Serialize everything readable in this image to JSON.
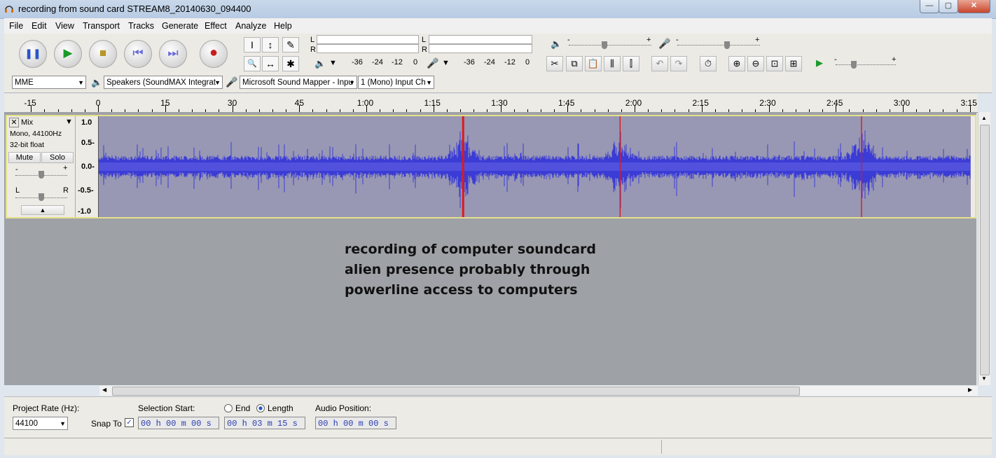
{
  "window": {
    "title": "recording from sound card STREAM8_20140630_094400",
    "minimize": "—",
    "maximize": "▢",
    "close": "✕"
  },
  "menu": [
    "File",
    "Edit",
    "View",
    "Transport",
    "Tracks",
    "Generate",
    "Effect",
    "Analyze",
    "Help"
  ],
  "transport": {
    "pause": "❚❚",
    "play": "▶",
    "stop": "■",
    "skip_start": "⏮",
    "skip_end": "⏭",
    "record": "●"
  },
  "tools": {
    "select": "I",
    "envelope": "↕",
    "draw": "✎",
    "zoom": "🔍",
    "timeshift": "↔",
    "multi": "✱"
  },
  "meters": {
    "play_L": "L",
    "play_R": "R",
    "rec_L": "L",
    "rec_R": "R",
    "scale": [
      "-36",
      "-24",
      "-12",
      "0"
    ]
  },
  "mixer": {
    "out_minus": "-",
    "out_plus": "+",
    "in_minus": "-",
    "in_plus": "+",
    "speed_minus": "-",
    "speed_plus": "+"
  },
  "devices": {
    "host": "MME",
    "output": "Speakers (SoundMAX Integrat",
    "input": "Microsoft Sound Mapper - Inpu",
    "channels": "1 (Mono) Input Ch"
  },
  "ruler": {
    "labels": [
      {
        "t": "-15",
        "s": -15
      },
      {
        "t": "0",
        "s": 0
      },
      {
        "t": "15",
        "s": 15
      },
      {
        "t": "30",
        "s": 30
      },
      {
        "t": "45",
        "s": 45
      },
      {
        "t": "1:00",
        "s": 60
      },
      {
        "t": "1:15",
        "s": 75
      },
      {
        "t": "1:30",
        "s": 90
      },
      {
        "t": "1:45",
        "s": 105
      },
      {
        "t": "2:00",
        "s": 120
      },
      {
        "t": "2:15",
        "s": 135
      },
      {
        "t": "2:30",
        "s": 150
      },
      {
        "t": "2:45",
        "s": 165
      },
      {
        "t": "3:00",
        "s": 180
      },
      {
        "t": "3:15",
        "s": 195
      }
    ]
  },
  "track": {
    "name": "Mix",
    "info_rate": "Mono, 44100Hz",
    "info_format": "32-bit float",
    "mute": "Mute",
    "solo": "Solo",
    "pan_L": "L",
    "pan_R": "R",
    "gain_minus": "-",
    "gain_plus": "+",
    "scale": [
      "1.0",
      "0.5-",
      "0.0-",
      "-0.5-",
      "-1.0"
    ],
    "markers_s": [
      81.5,
      116.6,
      170.6
    ]
  },
  "annotation": [
    "recording of computer soundcard",
    "alien presence probably through",
    "powerline access to computers"
  ],
  "selection": {
    "project_rate_label": "Project Rate (Hz):",
    "project_rate": "44100",
    "snap_to": "Snap To",
    "selection_start_label": "Selection Start:",
    "end_label": "End",
    "length_label": "Length",
    "audio_position_label": "Audio Position:",
    "start_value": "00 h 00 m 00 s",
    "length_value": "00 h 03 m 15 s",
    "position_value": "00 h 00 m 00 s"
  },
  "colors": {
    "waveform": "#3b3bd6",
    "wave_bg": "#9898b4",
    "marker": "#e01818",
    "track_border": "#e6e08a"
  }
}
